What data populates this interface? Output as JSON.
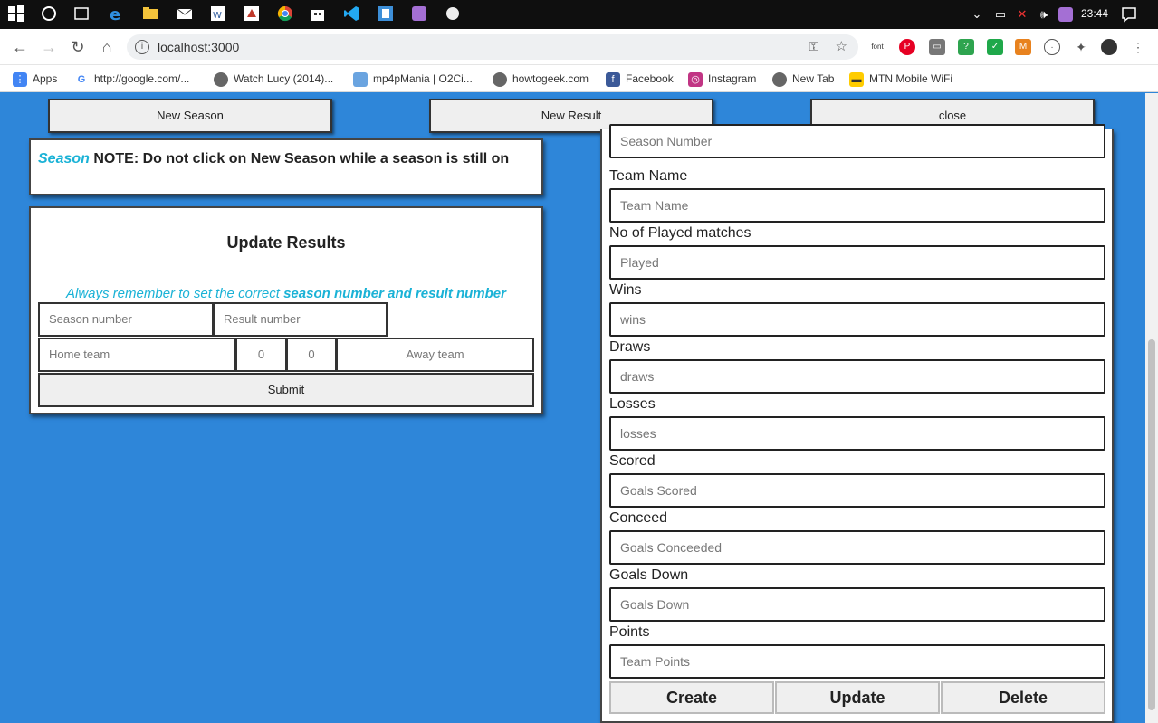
{
  "taskbar": {
    "time": "23:44"
  },
  "browser": {
    "url": "localhost:3000"
  },
  "bookmarks": [
    {
      "label": "Apps"
    },
    {
      "label": "http://google.com/..."
    },
    {
      "label": "Watch Lucy (2014)..."
    },
    {
      "label": "mp4pMania | O2Ci..."
    },
    {
      "label": "howtogeek.com"
    },
    {
      "label": "Facebook"
    },
    {
      "label": "Instagram"
    },
    {
      "label": "New Tab"
    },
    {
      "label": "MTN Mobile WiFi"
    }
  ],
  "top_buttons": {
    "new_season": "New Season",
    "new_result": "New Result",
    "close": "close"
  },
  "note": {
    "highlight": "Season",
    "text": " NOTE: Do not click on New Season while a season is still on"
  },
  "update_results": {
    "title": "Update Results",
    "hint_prefix": "Always remember to set the correct ",
    "hint_bold": "season number and result number",
    "season_placeholder": "Season number",
    "result_placeholder": "Result number",
    "home_placeholder": "Home team",
    "home_score": "0",
    "away_score": "0",
    "away_placeholder": "Away team",
    "submit": "Submit"
  },
  "team_form": {
    "season_placeholder": "Season Number",
    "fields": [
      {
        "label": "Team Name",
        "placeholder": "Team Name"
      },
      {
        "label": "No of Played matches",
        "placeholder": "Played"
      },
      {
        "label": "Wins",
        "placeholder": "wins"
      },
      {
        "label": "Draws",
        "placeholder": "draws"
      },
      {
        "label": "Losses",
        "placeholder": "losses"
      },
      {
        "label": "Scored",
        "placeholder": "Goals Scored"
      },
      {
        "label": "Conceed",
        "placeholder": "Goals Conceeded"
      },
      {
        "label": "Goals Down",
        "placeholder": "Goals Down"
      },
      {
        "label": "Points",
        "placeholder": "Team Points"
      }
    ],
    "buttons": {
      "create": "Create",
      "update": "Update",
      "delete": "Delete"
    }
  }
}
